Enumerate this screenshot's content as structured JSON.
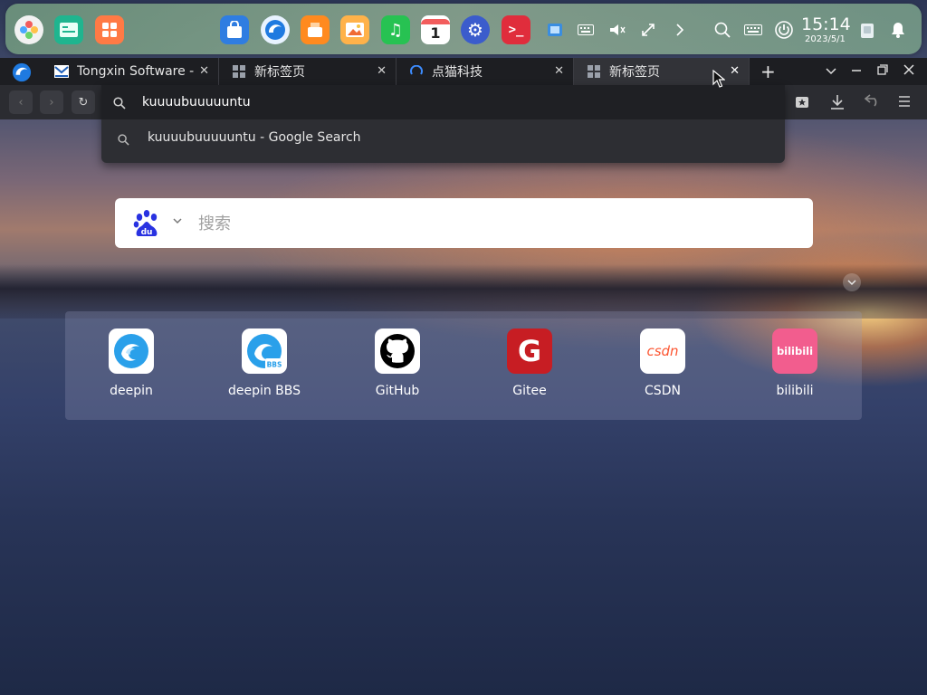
{
  "dock": {
    "apps": [
      "launcher-icon",
      "file-manager-icon",
      "app-store-icon",
      "shopping-icon",
      "browser-icon",
      "app-market-icon",
      "image-viewer-icon",
      "music-icon",
      "calendar-icon",
      "settings-icon",
      "terminal-icon"
    ],
    "calendar_day": "1",
    "tray": [
      "screenshot-icon",
      "keyboard-icon",
      "volume-icon",
      "network-icon",
      "expand-icon",
      "search-icon",
      "input-method-icon",
      "power-icon",
      "trash-icon",
      "notification-icon"
    ]
  },
  "clock": {
    "time": "15:14",
    "date": "2023/5/1"
  },
  "tabs": [
    {
      "label": "Tongxin Software -",
      "favicon": "tongxin-icon",
      "active": false
    },
    {
      "label": "新标签页",
      "favicon": "grid-icon",
      "active": false
    },
    {
      "label": "点猫科技",
      "favicon": "loading-icon",
      "active": false
    },
    {
      "label": "新标签页",
      "favicon": "grid-icon",
      "active": true
    }
  ],
  "address_bar": {
    "value": "kuuuubuuuuuntu",
    "suggestions": [
      {
        "text": "kuuuubuuuuuntu - Google Search",
        "icon": "search-icon"
      }
    ]
  },
  "search": {
    "engine": "baidu",
    "logo_text": "du",
    "placeholder": "搜索"
  },
  "speed_dial": [
    {
      "label": "deepin",
      "icon": "deepin-icon",
      "color": "#2aa0ea"
    },
    {
      "label": "deepin BBS",
      "icon": "deepin-bbs-icon",
      "badge": "BBS",
      "color": "#2aa0ea"
    },
    {
      "label": "GitHub",
      "icon": "github-icon",
      "color": "#000000"
    },
    {
      "label": "Gitee",
      "icon": "gitee-icon",
      "glyph": "G",
      "color": "#c71d23"
    },
    {
      "label": "CSDN",
      "icon": "csdn-icon",
      "glyph": "csdn",
      "color": "#fc5531"
    },
    {
      "label": "bilibili",
      "icon": "bilibili-icon",
      "glyph": "bilibili",
      "color": "#f25d8e"
    }
  ],
  "colors": {
    "tab_strip": "#1d1e22",
    "active_tab": "#323338",
    "dock": "#8fb59a"
  }
}
